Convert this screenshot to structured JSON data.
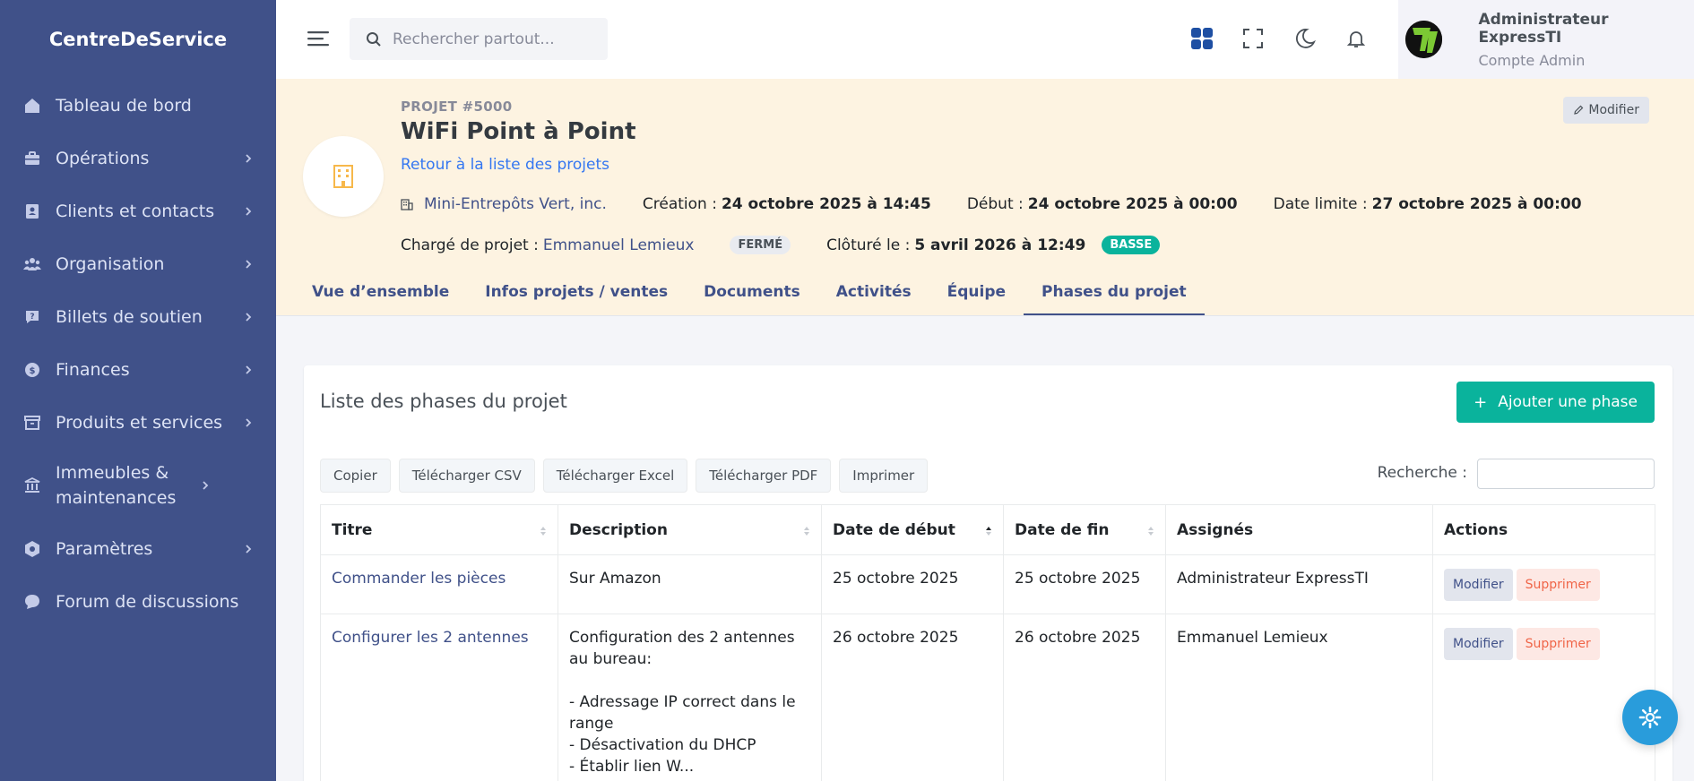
{
  "app": {
    "brand": "CentreDeService"
  },
  "sidebar": {
    "items": [
      {
        "label": "Tableau de bord",
        "icon": "home-icon"
      },
      {
        "label": "Opérations",
        "icon": "briefcase-icon"
      },
      {
        "label": "Clients et contacts",
        "icon": "contacts-icon"
      },
      {
        "label": "Organisation",
        "icon": "team-icon"
      },
      {
        "label": "Billets de soutien",
        "icon": "question-icon"
      },
      {
        "label": "Finances",
        "icon": "money-icon"
      },
      {
        "label": "Produits et services",
        "icon": "archive-icon"
      },
      {
        "label": "Immeubles & maintenances",
        "icon": "bank-icon"
      },
      {
        "label": "Paramètres",
        "icon": "settings-icon"
      },
      {
        "label": "Forum de discussions",
        "icon": "chat-icon"
      }
    ]
  },
  "topbar": {
    "search_placeholder": "Rechercher partout...",
    "user_name": "Administrateur ExpressTI",
    "user_role": "Compte Admin"
  },
  "project": {
    "number": "PROJET #5000",
    "title": "WiFi Point à Point",
    "back_link": "Retour à la liste des projets",
    "client": "Mini-Entrepôts Vert, inc.",
    "created_label": "Création :",
    "created_value": "24 octobre 2025 à 14:45",
    "start_label": "Début :",
    "start_value": "24 octobre 2025 à 00:00",
    "deadline_label": "Date limite :",
    "deadline_value": "27 octobre 2025 à 00:00",
    "manager_label": "Chargé de projet :",
    "manager_value": "Emmanuel Lemieux",
    "status_badge": "FERMÉ",
    "closed_label": "Clôturé le :",
    "closed_value": "5 avril 2026 à 12:49",
    "priority_badge": "BASSE",
    "edit_label": "Modifier",
    "tabs": [
      "Vue d’ensemble",
      "Infos projets / ventes",
      "Documents",
      "Activités",
      "Équipe",
      "Phases du projet"
    ],
    "active_tab": "Phases du projet"
  },
  "phases": {
    "title": "Liste des phases du projet",
    "add_label": "Ajouter une phase",
    "buttons": [
      "Copier",
      "Télécharger CSV",
      "Télécharger Excel",
      "Télécharger PDF",
      "Imprimer"
    ],
    "search_label": "Recherche :",
    "columns": [
      "Titre",
      "Description",
      "Date de début",
      "Date de fin",
      "Assignés",
      "Actions"
    ],
    "rows": [
      {
        "title": "Commander les pièces",
        "description": "Sur Amazon",
        "start": "25 octobre 2025",
        "end": "25 octobre 2025",
        "assigned": "Administrateur ExpressTI",
        "edit": "Modifier",
        "delete": "Supprimer"
      },
      {
        "title": "Configurer les 2 antennes",
        "description": "Configuration des 2 antennes au bureau:\n\n- Adressage IP correct dans le range\n- Désactivation du DHCP\n- Établir lien W...",
        "start": "26 octobre 2025",
        "end": "26 octobre 2025",
        "assigned": "Emmanuel Lemieux",
        "edit": "Modifier",
        "delete": "Supprimer"
      }
    ]
  },
  "colors": {
    "sidebar": "#405189",
    "accent": "#0ab39c",
    "header_bg": "#fdf3e1",
    "link": "#3577f1",
    "danger": "#f06548"
  }
}
